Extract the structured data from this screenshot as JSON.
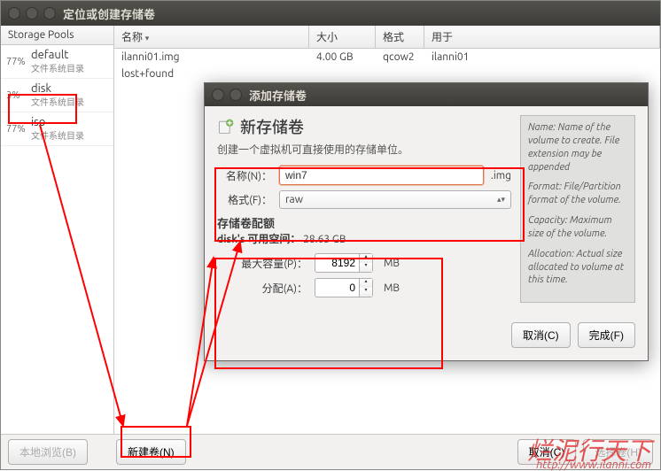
{
  "window": {
    "title": "定位或创建存储卷"
  },
  "sidebar": {
    "header": "Storage Pools",
    "items": [
      {
        "pct": "77%",
        "name": "default",
        "sub": "文件系统目录"
      },
      {
        "pct": "3%",
        "name": "disk",
        "sub": "文件系统目录"
      },
      {
        "pct": "77%",
        "name": "iso",
        "sub": "文件系统目录"
      }
    ]
  },
  "table": {
    "headers": {
      "name": "名称",
      "size": "大小",
      "fmt": "格式",
      "used": "用于"
    },
    "rows": [
      {
        "name": "ilanni01.img",
        "size": "4.00 GB",
        "fmt": "qcow2",
        "used": "ilanni01"
      },
      {
        "name": "lost+found",
        "size": "",
        "fmt": "",
        "used": ""
      }
    ]
  },
  "bottom": {
    "browse": "本地浏览(B)",
    "new_volume": "新建卷(N)",
    "cancel": "取消(C)",
    "choose": "选择卷(H)"
  },
  "dialog": {
    "title": "添加存储卷",
    "heading": "新存储卷",
    "desc": "创建一个虚拟机可直接使用的存储单位。",
    "name_label": "名称(N)：",
    "name_value": "win7",
    "name_suffix": ".img",
    "format_label": "格式(F)：",
    "format_value": "raw",
    "quota_title": "存储卷配额",
    "avail_label": "disk's 可用空间：",
    "avail_value": "28.63 GB",
    "max_label": "最大容量(P)：",
    "max_value": "8192",
    "alloc_label": "分配(A)：",
    "alloc_value": "0",
    "unit": "MB",
    "help": {
      "name": "Name: Name of the volume to create. File extension may be appended",
      "format": "Format: File/Partition format of the volume.",
      "capacity": "Capacity: Maximum size of the volume.",
      "allocation": "Allocation: Actual size allocated to volume at this time."
    },
    "cancel": "取消(C)",
    "finish": "完成(F)"
  },
  "watermark": {
    "text": "烂泥行天下",
    "url": "http://www.ilanni.com"
  }
}
